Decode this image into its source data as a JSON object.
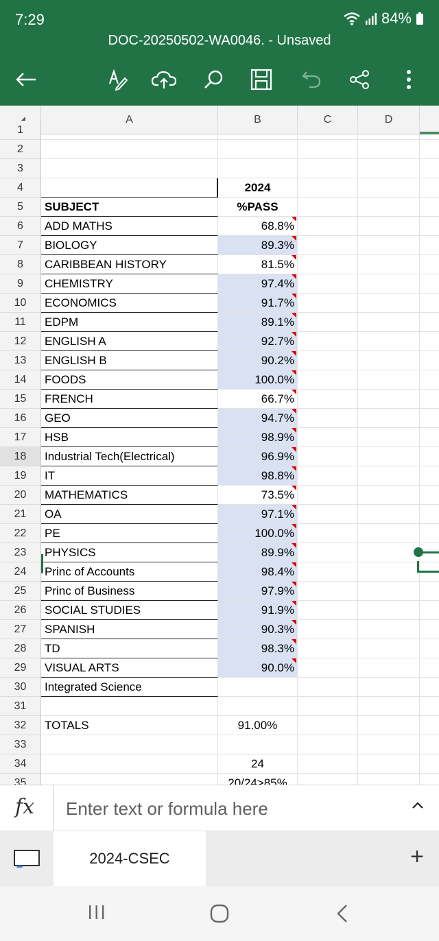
{
  "status": {
    "time": "7:29",
    "battery": "84%"
  },
  "document": {
    "title": "DOC-20250502-WA0046. - Unsaved"
  },
  "columns": [
    "A",
    "B",
    "C",
    "D"
  ],
  "rows": [
    {
      "num": "1",
      "a": "",
      "b": ""
    },
    {
      "num": "2",
      "a": "",
      "b": ""
    },
    {
      "num": "3",
      "a": "",
      "b": ""
    },
    {
      "num": "4",
      "a": "",
      "b": "2024"
    },
    {
      "num": "5",
      "a": "SUBJECT",
      "b": "%PASS"
    },
    {
      "num": "6",
      "a": "ADD MATHS",
      "b": "68.8%"
    },
    {
      "num": "7",
      "a": "BIOLOGY",
      "b": "89.3%"
    },
    {
      "num": "8",
      "a": "CARIBBEAN HISTORY",
      "b": "81.5%"
    },
    {
      "num": "9",
      "a": "CHEMISTRY",
      "b": "97.4%"
    },
    {
      "num": "10",
      "a": "ECONOMICS",
      "b": "91.7%"
    },
    {
      "num": "11",
      "a": "EDPM",
      "b": "89.1%"
    },
    {
      "num": "12",
      "a": "ENGLISH A",
      "b": "92.7%"
    },
    {
      "num": "13",
      "a": "ENGLISH B",
      "b": "90.2%"
    },
    {
      "num": "14",
      "a": "FOODS",
      "b": "100.0%"
    },
    {
      "num": "15",
      "a": "FRENCH",
      "b": "66.7%"
    },
    {
      "num": "16",
      "a": "GEO",
      "b": "94.7%"
    },
    {
      "num": "17",
      "a": "HSB",
      "b": "98.9%"
    },
    {
      "num": "18",
      "a": "Industrial Tech(Electrical)",
      "b": "96.9%"
    },
    {
      "num": "19",
      "a": "IT",
      "b": "98.8%"
    },
    {
      "num": "20",
      "a": "MATHEMATICS",
      "b": "73.5%"
    },
    {
      "num": "21",
      "a": "OA",
      "b": "97.1%"
    },
    {
      "num": "22",
      "a": "PE",
      "b": "100.0%"
    },
    {
      "num": "23",
      "a": "PHYSICS",
      "b": "89.9%"
    },
    {
      "num": "24",
      "a": "Princ of Accounts",
      "b": "98.4%"
    },
    {
      "num": "25",
      "a": "Princ of Business",
      "b": "97.9%"
    },
    {
      "num": "26",
      "a": "SOCIAL STUDIES",
      "b": "91.9%"
    },
    {
      "num": "27",
      "a": "SPANISH",
      "b": "90.3%"
    },
    {
      "num": "28",
      "a": "TD",
      "b": "98.3%"
    },
    {
      "num": "29",
      "a": "VISUAL ARTS",
      "b": "90.0%"
    },
    {
      "num": "30",
      "a": "Integrated Science",
      "b": ""
    },
    {
      "num": "31",
      "a": "",
      "b": ""
    },
    {
      "num": "32",
      "a": "TOTALS",
      "b": "91.00%"
    },
    {
      "num": "33",
      "a": "",
      "b": ""
    },
    {
      "num": "34",
      "a": "",
      "b": "24"
    },
    {
      "num": "35",
      "a": "",
      "b": "20/24>85%"
    }
  ],
  "formula_bar": {
    "placeholder": "Enter text or formula here"
  },
  "sheet_tab": {
    "label": "2024-CSEC"
  },
  "colors": {
    "header_green": "#217346",
    "cell_shade": "#d9e1f2",
    "comment_marker": "#e00000"
  }
}
